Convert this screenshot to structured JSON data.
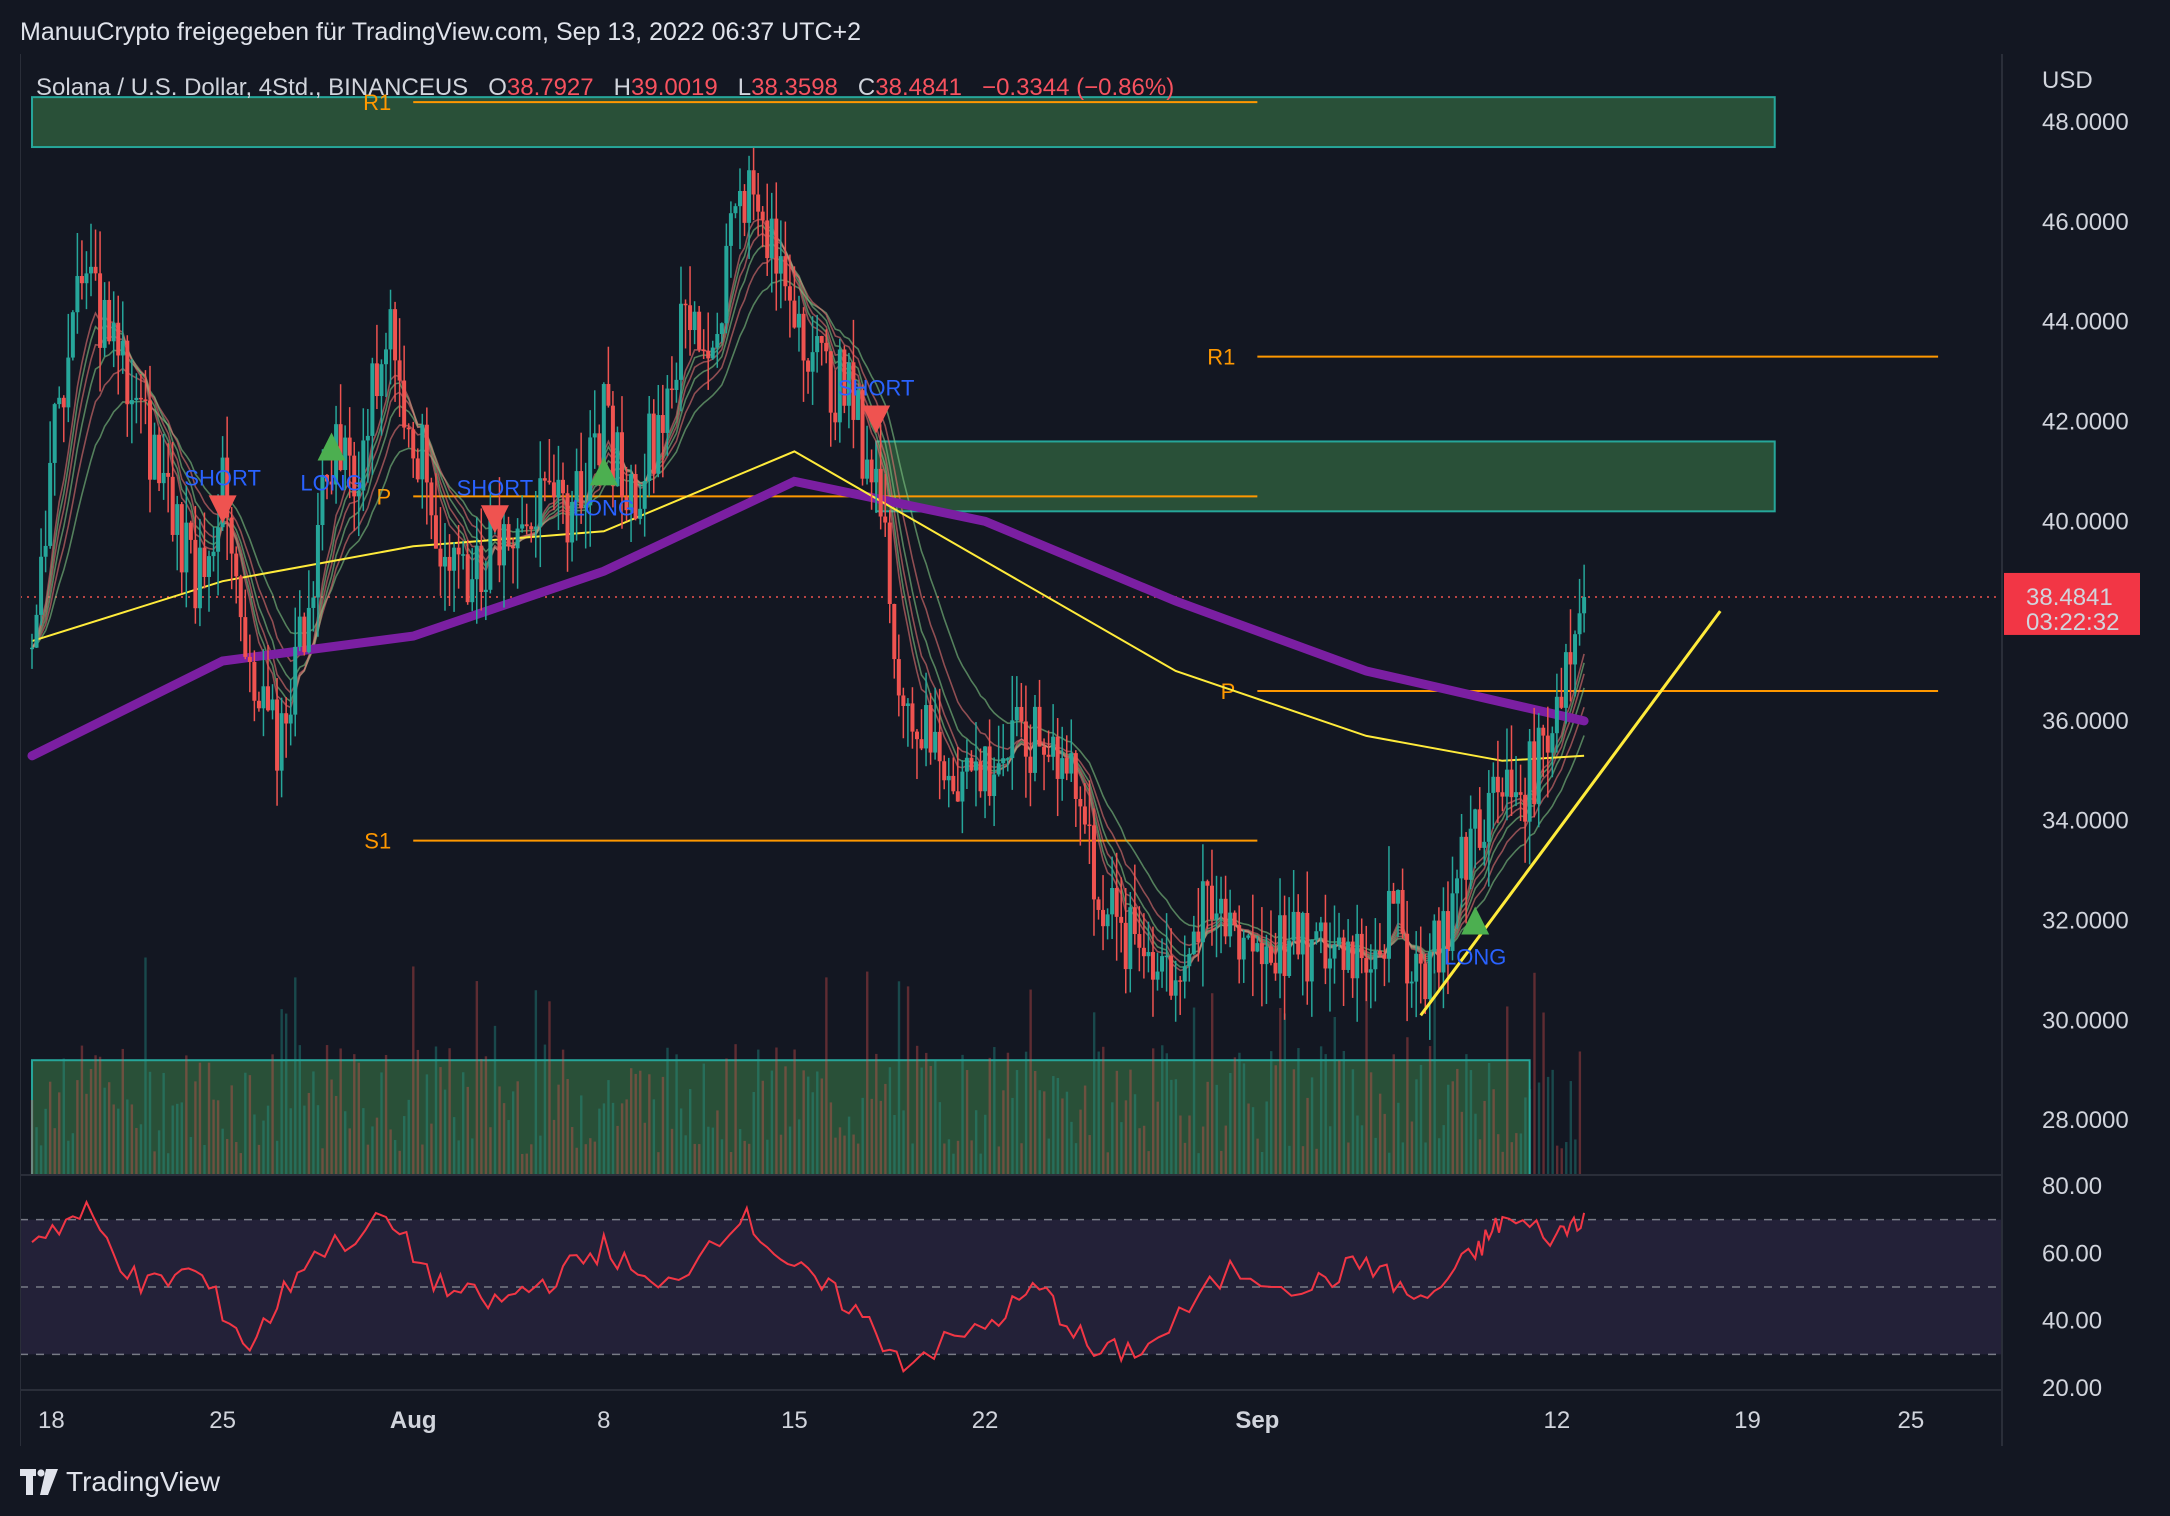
{
  "header": {
    "share_text": "ManuuCrypto freigegeben für TradingView.com, Sep 13, 2022 06:37 UTC+2"
  },
  "legend": {
    "symbol": "Solana / U.S. Dollar, 4Std., BINANCEUS",
    "o_label": "O",
    "o_value": "38.7927",
    "h_label": "H",
    "h_value": "39.0019",
    "l_label": "L",
    "l_value": "38.3598",
    "c_label": "C",
    "c_value": "38.4841",
    "change": "−0.3344 (−0.86%)"
  },
  "price_axis": {
    "currency": "USD",
    "ticks": [
      "48.0000",
      "46.0000",
      "44.0000",
      "42.0000",
      "40.0000",
      "38.4841",
      "36.0000",
      "34.0000",
      "32.0000",
      "30.0000",
      "28.0000"
    ],
    "last_price": "38.4841",
    "countdown": "03:22:32"
  },
  "rsi_axis": {
    "ticks": [
      "80.00",
      "60.00",
      "40.00",
      "20.00"
    ]
  },
  "time_axis": {
    "ticks": [
      "18",
      "25",
      "Aug",
      "8",
      "15",
      "22",
      "Sep",
      "12",
      "19",
      "25"
    ]
  },
  "footer": {
    "brand": "TradingView"
  },
  "colors": {
    "background": "#131722",
    "up": "#26a69a",
    "down": "#ef5350",
    "ma200": "#7b1fa2",
    "ma_yellow": "#ffeb3b",
    "pivot": "#ff9800",
    "signal_text": "#2962ff",
    "rsi": "#f23645",
    "zone_fill": "#2e5b3c",
    "zone_border": "#26a69a"
  },
  "chart_data": [
    {
      "type": "candlestick",
      "symbol": "SOLUSD",
      "timeframe": "4h",
      "exchange": "BINANCEUS",
      "ylim": [
        27,
        48.3
      ],
      "x_ticks": [
        "18",
        "25",
        "Aug",
        "8",
        "15",
        "22",
        "Sep",
        "12",
        "19",
        "25"
      ],
      "ohlc_last": {
        "open": 38.7927,
        "high": 39.0019,
        "low": 38.3598,
        "close": 38.4841
      },
      "change": -0.3344,
      "change_pct": -0.86,
      "close_path": [
        {
          "date": "2022-07-18",
          "close": 37.5
        },
        {
          "date": "2022-07-19",
          "close": 42.5
        },
        {
          "date": "2022-07-20",
          "close": 45.0
        },
        {
          "date": "2022-07-21",
          "close": 43.5
        },
        {
          "date": "2022-07-22",
          "close": 42.0
        },
        {
          "date": "2022-07-23",
          "close": 40.5
        },
        {
          "date": "2022-07-24",
          "close": 39.0
        },
        {
          "date": "2022-07-25",
          "close": 40.5
        },
        {
          "date": "2022-07-26",
          "close": 36.5
        },
        {
          "date": "2022-07-27",
          "close": 35.5
        },
        {
          "date": "2022-07-28",
          "close": 38.0
        },
        {
          "date": "2022-07-29",
          "close": 41.5
        },
        {
          "date": "2022-07-30",
          "close": 41.0
        },
        {
          "date": "2022-07-31",
          "close": 44.0
        },
        {
          "date": "2022-08-01",
          "close": 42.0
        },
        {
          "date": "2022-08-02",
          "close": 39.5
        },
        {
          "date": "2022-08-03",
          "close": 39.0
        },
        {
          "date": "2022-08-04",
          "close": 39.5
        },
        {
          "date": "2022-08-05",
          "close": 40.5
        },
        {
          "date": "2022-08-06",
          "close": 40.0
        },
        {
          "date": "2022-08-07",
          "close": 40.5
        },
        {
          "date": "2022-08-08",
          "close": 42.0
        },
        {
          "date": "2022-08-09",
          "close": 40.5
        },
        {
          "date": "2022-08-10",
          "close": 42.0
        },
        {
          "date": "2022-08-11",
          "close": 44.0
        },
        {
          "date": "2022-08-12",
          "close": 43.5
        },
        {
          "date": "2022-08-13",
          "close": 47.0
        },
        {
          "date": "2022-08-14",
          "close": 45.5
        },
        {
          "date": "2022-08-15",
          "close": 44.5
        },
        {
          "date": "2022-08-16",
          "close": 43.0
        },
        {
          "date": "2022-08-17",
          "close": 42.5
        },
        {
          "date": "2022-08-18",
          "close": 40.8
        },
        {
          "date": "2022-08-19",
          "close": 36.5
        },
        {
          "date": "2022-08-20",
          "close": 35.5
        },
        {
          "date": "2022-08-21",
          "close": 35.0
        },
        {
          "date": "2022-08-22",
          "close": 35.0
        },
        {
          "date": "2022-08-23",
          "close": 35.5
        },
        {
          "date": "2022-08-24",
          "close": 35.5
        },
        {
          "date": "2022-08-25",
          "close": 35.5
        },
        {
          "date": "2022-08-26",
          "close": 33.0
        },
        {
          "date": "2022-08-27",
          "close": 31.5
        },
        {
          "date": "2022-08-28",
          "close": 31.5
        },
        {
          "date": "2022-08-29",
          "close": 31.0
        },
        {
          "date": "2022-08-30",
          "close": 32.0
        },
        {
          "date": "2022-08-31",
          "close": 32.0
        },
        {
          "date": "2022-09-01",
          "close": 31.5
        },
        {
          "date": "2022-09-02",
          "close": 31.5
        },
        {
          "date": "2022-09-03",
          "close": 31.3
        },
        {
          "date": "2022-09-04",
          "close": 31.5
        },
        {
          "date": "2022-09-05",
          "close": 31.5
        },
        {
          "date": "2022-09-06",
          "close": 32.0
        },
        {
          "date": "2022-09-07",
          "close": 31.0
        },
        {
          "date": "2022-09-08",
          "close": 32.0
        },
        {
          "date": "2022-09-09",
          "close": 34.0
        },
        {
          "date": "2022-09-10",
          "close": 34.5
        },
        {
          "date": "2022-09-11",
          "close": 34.8
        },
        {
          "date": "2022-09-12",
          "close": 36.5
        },
        {
          "date": "2022-09-13",
          "close": 38.48
        }
      ],
      "overlays": {
        "pivot_levels": [
          {
            "label": "R1",
            "value": 43.3,
            "from": "2022-09-01",
            "to": "2022-09-26"
          },
          {
            "label": "P",
            "value": 36.6,
            "from": "2022-09-01",
            "to": "2022-09-26"
          },
          {
            "label": "P",
            "value": 40.5,
            "from": "2022-08-01",
            "to": "2022-09-01"
          },
          {
            "label": "S1",
            "value": 33.6,
            "from": "2022-08-01",
            "to": "2022-09-01"
          },
          {
            "label": "R1",
            "value": 48.4,
            "from": "2022-08-01",
            "to": "2022-09-01"
          }
        ],
        "zones": [
          {
            "name": "resistance-zone-upper",
            "from": "2022-07-18",
            "to": "2022-09-20",
            "low": 47.5,
            "high": 48.5
          },
          {
            "name": "resistance-zone",
            "from": "2022-08-18",
            "to": "2022-09-20",
            "low": 40.2,
            "high": 41.6
          },
          {
            "name": "volume-zone",
            "from": "2022-07-18",
            "to": "2022-09-11",
            "low": 26.9,
            "high": 29.2
          }
        ],
        "signals": [
          {
            "label": "SHORT",
            "date": "2022-07-25",
            "price": 40.2
          },
          {
            "label": "LONG",
            "date": "2022-07-29",
            "price": 41.5
          },
          {
            "label": "SHORT",
            "date": "2022-08-04",
            "price": 40.0
          },
          {
            "label": "LONG",
            "date": "2022-08-08",
            "price": 41.0
          },
          {
            "label": "SHORT",
            "date": "2022-08-18",
            "price": 42.0
          },
          {
            "label": "LONG",
            "date": "2022-09-09",
            "price": 32.0
          }
        ],
        "trendline": {
          "from": {
            "date": "2022-09-07",
            "price": 30.1
          },
          "to": {
            "date": "2022-09-18",
            "price": 38.2
          }
        },
        "ma200_path": [
          {
            "date": "2022-07-18",
            "value": 35.3
          },
          {
            "date": "2022-07-25",
            "value": 37.2
          },
          {
            "date": "2022-08-01",
            "value": 37.7
          },
          {
            "date": "2022-08-08",
            "value": 39.0
          },
          {
            "date": "2022-08-15",
            "value": 40.8
          },
          {
            "date": "2022-08-22",
            "value": 40.0
          },
          {
            "date": "2022-08-29",
            "value": 38.4
          },
          {
            "date": "2022-09-05",
            "value": 37.0
          },
          {
            "date": "2022-09-13",
            "value": 36.0
          }
        ],
        "ma_yellow_path": [
          {
            "date": "2022-07-18",
            "value": 37.6
          },
          {
            "date": "2022-07-25",
            "value": 38.8
          },
          {
            "date": "2022-08-01",
            "value": 39.5
          },
          {
            "date": "2022-08-08",
            "value": 39.8
          },
          {
            "date": "2022-08-15",
            "value": 41.4
          },
          {
            "date": "2022-08-22",
            "value": 39.2
          },
          {
            "date": "2022-08-29",
            "value": 37.0
          },
          {
            "date": "2022-09-05",
            "value": 35.7
          },
          {
            "date": "2022-09-10",
            "value": 35.2
          },
          {
            "date": "2022-09-13",
            "value": 35.3
          }
        ]
      }
    },
    {
      "type": "line",
      "name": "RSI",
      "ylim": [
        20,
        80
      ],
      "bands": [
        30,
        50,
        70
      ],
      "y_ticks": [
        "80.00",
        "60.00",
        "40.00",
        "20.00"
      ],
      "values": [
        {
          "date": "2022-07-18",
          "value": 65
        },
        {
          "date": "2022-07-20",
          "value": 72
        },
        {
          "date": "2022-07-22",
          "value": 50
        },
        {
          "date": "2022-07-24",
          "value": 55
        },
        {
          "date": "2022-07-26",
          "value": 32
        },
        {
          "date": "2022-07-28",
          "value": 58
        },
        {
          "date": "2022-07-31",
          "value": 70
        },
        {
          "date": "2022-08-02",
          "value": 50
        },
        {
          "date": "2022-08-04",
          "value": 45
        },
        {
          "date": "2022-08-06",
          "value": 52
        },
        {
          "date": "2022-08-08",
          "value": 62
        },
        {
          "date": "2022-08-10",
          "value": 48
        },
        {
          "date": "2022-08-13",
          "value": 72
        },
        {
          "date": "2022-08-15",
          "value": 55
        },
        {
          "date": "2022-08-17",
          "value": 45
        },
        {
          "date": "2022-08-19",
          "value": 28
        },
        {
          "date": "2022-08-22",
          "value": 38
        },
        {
          "date": "2022-08-24",
          "value": 50
        },
        {
          "date": "2022-08-26",
          "value": 30
        },
        {
          "date": "2022-08-28",
          "value": 32
        },
        {
          "date": "2022-08-31",
          "value": 55
        },
        {
          "date": "2022-09-03",
          "value": 50
        },
        {
          "date": "2022-09-05",
          "value": 58
        },
        {
          "date": "2022-09-07",
          "value": 45
        },
        {
          "date": "2022-09-09",
          "value": 60
        },
        {
          "date": "2022-09-10",
          "value": 70
        },
        {
          "date": "2022-09-12",
          "value": 65
        },
        {
          "date": "2022-09-13",
          "value": 72
        }
      ]
    }
  ]
}
